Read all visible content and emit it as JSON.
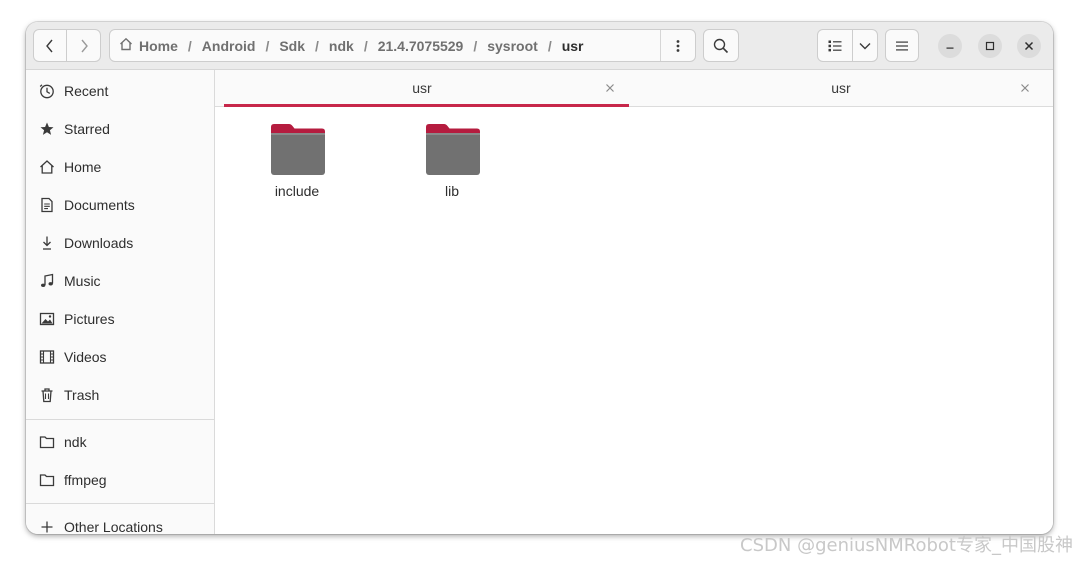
{
  "header": {
    "breadcrumbs": [
      {
        "label": "Home"
      },
      {
        "label": "Android"
      },
      {
        "label": "Sdk"
      },
      {
        "label": "ndk"
      },
      {
        "label": "21.4.7075529"
      },
      {
        "label": "sysroot"
      },
      {
        "label": "usr"
      }
    ],
    "separator": "/"
  },
  "sidebar": {
    "places": [
      {
        "label": "Recent",
        "icon": "clock-icon"
      },
      {
        "label": "Starred",
        "icon": "star-icon"
      },
      {
        "label": "Home",
        "icon": "home-icon"
      },
      {
        "label": "Documents",
        "icon": "document-icon"
      },
      {
        "label": "Downloads",
        "icon": "download-icon"
      },
      {
        "label": "Music",
        "icon": "music-note-icon"
      },
      {
        "label": "Pictures",
        "icon": "picture-icon"
      },
      {
        "label": "Videos",
        "icon": "film-icon"
      },
      {
        "label": "Trash",
        "icon": "trash-icon"
      }
    ],
    "bookmarks": [
      {
        "label": "ndk",
        "icon": "folder-icon"
      },
      {
        "label": "ffmpeg",
        "icon": "folder-icon"
      }
    ],
    "other_locations": {
      "label": "Other Locations",
      "icon": "plus-icon"
    }
  },
  "tabs": [
    {
      "label": "usr",
      "active": true
    },
    {
      "label": "usr",
      "active": false
    }
  ],
  "files": [
    {
      "name": "include",
      "type": "folder"
    },
    {
      "name": "lib",
      "type": "folder"
    }
  ],
  "watermark": "CSDN @geniusNMRobot专家_中国股神",
  "colors": {
    "accent": "#c7274a",
    "folder_body": "#717171",
    "folder_tab": "#b51c3f"
  }
}
